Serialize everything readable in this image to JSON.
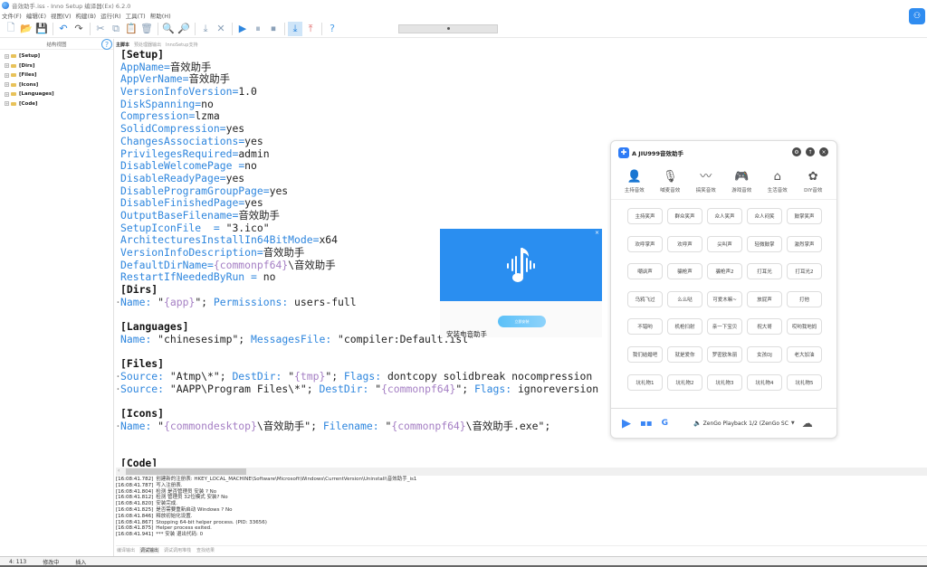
{
  "window": {
    "title": "音效助手.iss - Inno Setup 编译器(Ex) 6.2.0"
  },
  "menu": [
    "文件(F)",
    "编辑(E)",
    "视图(V)",
    "构建(B)",
    "运行(R)",
    "工具(T)",
    "帮助(H)"
  ],
  "toolbar": {
    "buttons": [
      {
        "name": "new-file",
        "glyph": "🗋"
      },
      {
        "name": "open-file",
        "glyph": "📂"
      },
      {
        "name": "save",
        "glyph": "💾"
      },
      {
        "name": "undo",
        "glyph": "↶"
      },
      {
        "name": "redo",
        "glyph": "↷"
      },
      {
        "name": "cut",
        "glyph": "✂"
      },
      {
        "name": "copy",
        "glyph": "⧉"
      },
      {
        "name": "paste",
        "glyph": "📋"
      },
      {
        "name": "delete",
        "glyph": "🗑"
      },
      {
        "name": "find",
        "glyph": "🔍"
      },
      {
        "name": "replace",
        "glyph": "🔎"
      },
      {
        "name": "compile",
        "glyph": "⤓"
      },
      {
        "name": "stop-compile",
        "glyph": "✕"
      },
      {
        "name": "run",
        "glyph": "▶"
      },
      {
        "name": "pause",
        "glyph": "⏸"
      },
      {
        "name": "stop",
        "glyph": "⏹"
      },
      {
        "name": "target-download",
        "glyph": "⤓"
      },
      {
        "name": "target-upload",
        "glyph": "⤒"
      },
      {
        "name": "help",
        "glyph": "?"
      }
    ]
  },
  "structure_panel": {
    "title": "结构视图",
    "help_glyph": "?",
    "items": [
      "[Setup]",
      "[Dirs]",
      "[Files]",
      "[Icons]",
      "[Languages]",
      "[Code]"
    ]
  },
  "editor": {
    "tabs": [
      "主脚本",
      "预处理器输出",
      "InnoSetup支持"
    ],
    "active_tab": 0,
    "lines": [
      {
        "marked": false,
        "parts": [
          {
            "t": "[Setup]",
            "c": "sec"
          }
        ]
      },
      {
        "marked": false,
        "parts": [
          {
            "t": "AppName",
            "c": "kw"
          },
          {
            "t": "=",
            "c": "kw"
          },
          {
            "t": "音效助手",
            "c": "val"
          }
        ]
      },
      {
        "marked": false,
        "parts": [
          {
            "t": "AppVerName",
            "c": "kw"
          },
          {
            "t": "=",
            "c": "kw"
          },
          {
            "t": "音效助手",
            "c": "val"
          }
        ]
      },
      {
        "marked": false,
        "parts": [
          {
            "t": "VersionInfoVersion",
            "c": "kw"
          },
          {
            "t": "=",
            "c": "kw"
          },
          {
            "t": "1.0",
            "c": "val"
          }
        ]
      },
      {
        "marked": false,
        "parts": [
          {
            "t": "DiskSpanning",
            "c": "kw"
          },
          {
            "t": "=",
            "c": "kw"
          },
          {
            "t": "no",
            "c": "val"
          }
        ]
      },
      {
        "marked": false,
        "parts": [
          {
            "t": "Compression",
            "c": "kw"
          },
          {
            "t": "=",
            "c": "kw"
          },
          {
            "t": "lzma",
            "c": "val"
          }
        ]
      },
      {
        "marked": false,
        "parts": [
          {
            "t": "SolidCompression",
            "c": "kw"
          },
          {
            "t": "=",
            "c": "kw"
          },
          {
            "t": "yes",
            "c": "val"
          }
        ]
      },
      {
        "marked": false,
        "parts": [
          {
            "t": "ChangesAssociations",
            "c": "kw"
          },
          {
            "t": "=",
            "c": "kw"
          },
          {
            "t": "yes",
            "c": "val"
          }
        ]
      },
      {
        "marked": false,
        "parts": [
          {
            "t": "PrivilegesRequired",
            "c": "kw"
          },
          {
            "t": "=",
            "c": "kw"
          },
          {
            "t": "admin",
            "c": "val"
          }
        ]
      },
      {
        "marked": false,
        "parts": [
          {
            "t": "DisableWelcomePage ",
            "c": "kw"
          },
          {
            "t": "=",
            "c": "kw"
          },
          {
            "t": "no",
            "c": "val"
          }
        ]
      },
      {
        "marked": false,
        "parts": [
          {
            "t": "DisableReadyPage",
            "c": "kw"
          },
          {
            "t": "=",
            "c": "kw"
          },
          {
            "t": "yes",
            "c": "val"
          }
        ]
      },
      {
        "marked": false,
        "parts": [
          {
            "t": "DisableProgramGroupPage",
            "c": "kw"
          },
          {
            "t": "=",
            "c": "kw"
          },
          {
            "t": "yes",
            "c": "val"
          }
        ]
      },
      {
        "marked": false,
        "parts": [
          {
            "t": "DisableFinishedPage",
            "c": "kw"
          },
          {
            "t": "=",
            "c": "kw"
          },
          {
            "t": "yes",
            "c": "val"
          }
        ]
      },
      {
        "marked": false,
        "parts": [
          {
            "t": "OutputBaseFilename",
            "c": "kw"
          },
          {
            "t": "=",
            "c": "kw"
          },
          {
            "t": "音效助手",
            "c": "val"
          }
        ]
      },
      {
        "marked": false,
        "parts": [
          {
            "t": "SetupIconFile  ",
            "c": "kw"
          },
          {
            "t": "= ",
            "c": "kw"
          },
          {
            "t": "\"3.ico\"",
            "c": "val"
          }
        ]
      },
      {
        "marked": false,
        "parts": [
          {
            "t": "ArchitecturesInstallIn64BitMode",
            "c": "kw"
          },
          {
            "t": "=",
            "c": "kw"
          },
          {
            "t": "x64",
            "c": "val"
          }
        ]
      },
      {
        "marked": false,
        "parts": [
          {
            "t": "VersionInfoDescription",
            "c": "kw"
          },
          {
            "t": "=",
            "c": "kw"
          },
          {
            "t": "音效助手",
            "c": "val"
          }
        ]
      },
      {
        "marked": false,
        "parts": [
          {
            "t": "DefaultDirName",
            "c": "kw"
          },
          {
            "t": "=",
            "c": "kw"
          },
          {
            "t": "{commonpf64}",
            "c": "const"
          },
          {
            "t": "\\音效助手",
            "c": "val"
          }
        ]
      },
      {
        "marked": false,
        "parts": [
          {
            "t": "RestartIfNeededByRun",
            "c": "kw"
          },
          {
            "t": " = ",
            "c": "kw"
          },
          {
            "t": "no",
            "c": "val"
          }
        ]
      },
      {
        "marked": false,
        "parts": [
          {
            "t": "[Dirs]",
            "c": "sec"
          }
        ]
      },
      {
        "marked": true,
        "parts": [
          {
            "t": "Name",
            "c": "kw"
          },
          {
            "t": ": ",
            "c": "kw"
          },
          {
            "t": "\"",
            "c": "val"
          },
          {
            "t": "{app}",
            "c": "const"
          },
          {
            "t": "\"; ",
            "c": "val"
          },
          {
            "t": "Permissions",
            "c": "kw"
          },
          {
            "t": ": ",
            "c": "kw"
          },
          {
            "t": "users-full",
            "c": "val"
          }
        ]
      },
      {
        "marked": false,
        "parts": [
          {
            "t": "",
            "c": "val"
          }
        ]
      },
      {
        "marked": false,
        "parts": [
          {
            "t": "[Languages]",
            "c": "sec"
          }
        ]
      },
      {
        "marked": false,
        "parts": [
          {
            "t": "Name",
            "c": "kw"
          },
          {
            "t": ": ",
            "c": "kw"
          },
          {
            "t": "\"chinesesimp\"; ",
            "c": "val"
          },
          {
            "t": "MessagesFile",
            "c": "kw"
          },
          {
            "t": ": ",
            "c": "kw"
          },
          {
            "t": "\"compiler:Default.isl\"",
            "c": "val"
          }
        ]
      },
      {
        "marked": false,
        "parts": [
          {
            "t": "",
            "c": "val"
          }
        ]
      },
      {
        "marked": false,
        "parts": [
          {
            "t": "[Files]",
            "c": "sec"
          }
        ]
      },
      {
        "marked": true,
        "parts": [
          {
            "t": "Source",
            "c": "kw"
          },
          {
            "t": ": ",
            "c": "kw"
          },
          {
            "t": "\"Atmp\\*\"; ",
            "c": "val"
          },
          {
            "t": "DestDir",
            "c": "kw"
          },
          {
            "t": ": ",
            "c": "kw"
          },
          {
            "t": "\"",
            "c": "val"
          },
          {
            "t": "{tmp}",
            "c": "const"
          },
          {
            "t": "\"; ",
            "c": "val"
          },
          {
            "t": "Flags",
            "c": "kw"
          },
          {
            "t": ": ",
            "c": "kw"
          },
          {
            "t": "dontcopy solidbreak nocompression",
            "c": "val"
          }
        ]
      },
      {
        "marked": true,
        "parts": [
          {
            "t": "Source",
            "c": "kw"
          },
          {
            "t": ": ",
            "c": "kw"
          },
          {
            "t": "\"AAPP\\Program Files\\*\"; ",
            "c": "val"
          },
          {
            "t": "DestDir",
            "c": "kw"
          },
          {
            "t": ": ",
            "c": "kw"
          },
          {
            "t": "\"",
            "c": "val"
          },
          {
            "t": "{commonpf64}",
            "c": "const"
          },
          {
            "t": "\"; ",
            "c": "val"
          },
          {
            "t": "Flags",
            "c": "kw"
          },
          {
            "t": ": ",
            "c": "kw"
          },
          {
            "t": "ignoreversion",
            "c": "val"
          }
        ]
      },
      {
        "marked": false,
        "parts": [
          {
            "t": "",
            "c": "val"
          }
        ]
      },
      {
        "marked": false,
        "parts": [
          {
            "t": "[Icons]",
            "c": "sec"
          }
        ]
      },
      {
        "marked": true,
        "parts": [
          {
            "t": "Name",
            "c": "kw"
          },
          {
            "t": ": ",
            "c": "kw"
          },
          {
            "t": "\"",
            "c": "val"
          },
          {
            "t": "{commondesktop}",
            "c": "const"
          },
          {
            "t": "\\音效助手\"; ",
            "c": "val"
          },
          {
            "t": "Filename",
            "c": "kw"
          },
          {
            "t": ": ",
            "c": "kw"
          },
          {
            "t": "\"",
            "c": "val"
          },
          {
            "t": "{commonpf64}",
            "c": "const"
          },
          {
            "t": "\\音效助手.exe\";",
            "c": "val"
          }
        ]
      },
      {
        "marked": false,
        "parts": [
          {
            "t": "",
            "c": "val"
          }
        ]
      },
      {
        "marked": false,
        "parts": [
          {
            "t": "",
            "c": "val"
          }
        ]
      },
      {
        "marked": false,
        "parts": [
          {
            "t": "[Code]",
            "c": "sec"
          }
        ]
      }
    ]
  },
  "log": {
    "lines": [
      {
        "ts": "[16:08:41.782]",
        "msg": "创建新的注册表: HKEY_LOCAL_MACHINE\\Software\\Microsoft\\Windows\\CurrentVersion\\Uninstall\\音效助手_is1"
      },
      {
        "ts": "[16:08:41.787]",
        "msg": "写入注册表."
      },
      {
        "ts": "[16:08:41.804]",
        "msg": "检测 是否管理员 安装 ? No"
      },
      {
        "ts": "[16:08:41.812]",
        "msg": "检测 管理员 32位模式 安装? No"
      },
      {
        "ts": "[16:08:41.820]",
        "msg": "安装完成."
      },
      {
        "ts": "[16:08:41.825]",
        "msg": "是否需要重新启动 Windows ? No"
      },
      {
        "ts": "[16:08:41.846]",
        "msg": "释放初始化设置."
      },
      {
        "ts": "[16:08:41.867]",
        "msg": "Stopping 64-bit helper process. (PID: 33656)"
      },
      {
        "ts": "[16:08:41.875]",
        "msg": "Helper process exited."
      },
      {
        "ts": "[16:08:41.941]",
        "msg": "*** 安装 退出代码: 0"
      }
    ],
    "tabs": [
      "编译输出",
      "调试输出",
      "调试调用堆栈",
      "查找结果"
    ],
    "active_tab": 1
  },
  "statusbar": {
    "position": "4: 113",
    "modified": "修改中",
    "mode": "插入"
  },
  "installer_popup": {
    "close_glyph": "×",
    "install_button": "立即安装",
    "caption": "安装电音助手"
  },
  "sound_assistant": {
    "title": "A JIU999音效助手",
    "header_buttons": [
      {
        "name": "settings",
        "glyph": "⚙"
      },
      {
        "name": "pin",
        "glyph": "↑"
      },
      {
        "name": "close",
        "glyph": "×"
      }
    ],
    "categories": [
      {
        "label": "主持音效",
        "icon": "person-icon",
        "glyph": "👤"
      },
      {
        "label": "喊麦音效",
        "icon": "microphone-icon",
        "glyph": "🎙"
      },
      {
        "label": "搞笑音效",
        "icon": "waveform-icon",
        "glyph": "〰"
      },
      {
        "label": "游戏音效",
        "icon": "gamepad-icon",
        "glyph": "🎮"
      },
      {
        "label": "生活音效",
        "icon": "home-icon",
        "glyph": "⌂"
      },
      {
        "label": "DIY音效",
        "icon": "puzzle-icon",
        "glyph": "✿"
      }
    ],
    "sounds": [
      "主持笑声",
      "群众笑声",
      "众人笑声",
      "众人闷笑",
      "鼓掌笑声",
      "欢呼掌声",
      "欢呼声",
      "尖叫声",
      "轻微鼓掌",
      "激烈掌声",
      "嘲讽声",
      "骗枪声",
      "骗枪声2",
      "打耳光",
      "打耳光2",
      "乌鸦飞过",
      "么么哒",
      "可爱木嘛~",
      "放屁声",
      "打他",
      "不错哟",
      "机枪扫射",
      "亲一下宝贝",
      "祝大哥",
      "哎哟我地妈",
      "我们结婚吧",
      "就是爱你",
      "罗密欧朱丽",
      "女孩DJ",
      "老大加油",
      "坑礼物1",
      "坑礼物2",
      "坑礼物3",
      "坑礼物4",
      "坑礼物5"
    ],
    "footer": {
      "device": "ZenGo Playback 1/2 (ZenGo SC",
      "play_glyph": "▶",
      "apps_glyph": "▪▪",
      "g_glyph": "G",
      "speaker_glyph": "🔈",
      "caret_glyph": "▼",
      "cloud_glyph": "☁"
    }
  },
  "top_right_badge_glyph": "⚇"
}
